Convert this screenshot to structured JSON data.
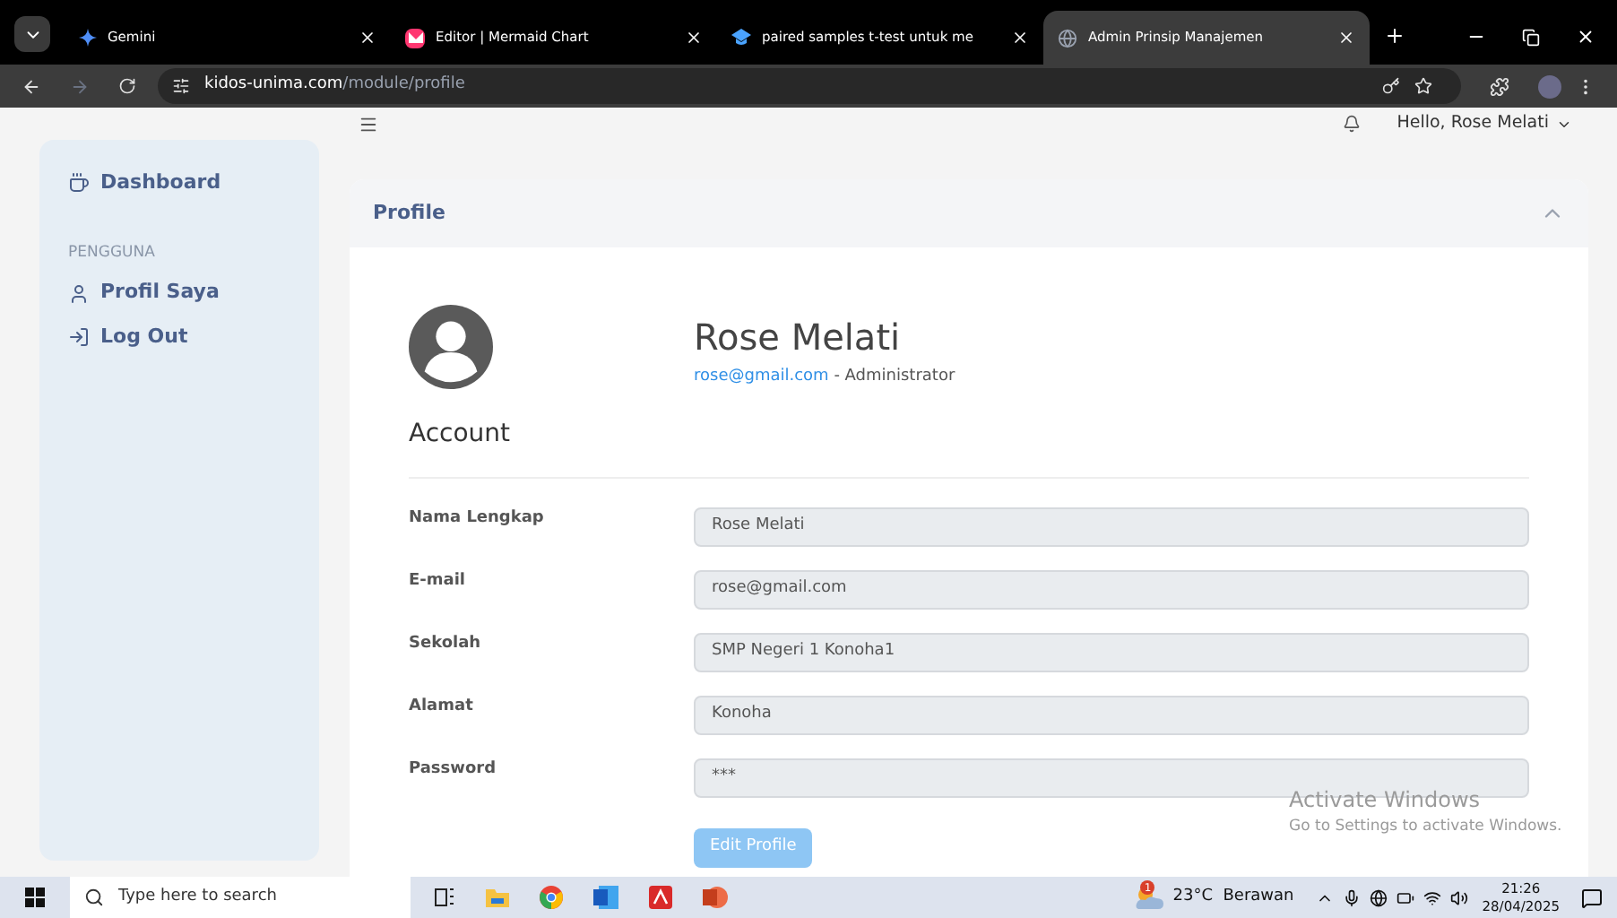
{
  "browser": {
    "tabs": [
      {
        "title": "Gemini",
        "kind": "gemini",
        "selected": false
      },
      {
        "title": "Editor | Mermaid Chart",
        "kind": "mermaid",
        "selected": false
      },
      {
        "title": "paired samples t-test untuk me",
        "kind": "edu",
        "selected": false
      },
      {
        "title": "Admin Prinsip Manajemen",
        "kind": "globe",
        "selected": true
      }
    ],
    "url_host": "kidos-unima.com",
    "url_path": "/module/profile"
  },
  "topbar": {
    "greeting": "Hello, Rose Melati"
  },
  "sidebar": {
    "items": [
      {
        "label": "Dashboard",
        "kind": "dashboard",
        "selected": false
      }
    ],
    "section": "PENGGUNA",
    "section_items": [
      {
        "label": "Profil Saya",
        "kind": "user",
        "selected": false
      },
      {
        "label": "Log Out",
        "kind": "logout",
        "selected": false
      }
    ]
  },
  "card": {
    "title": "Profile",
    "name": "Rose Melati",
    "email": "rose@gmail.com",
    "role": " - Administrator",
    "account_heading": "Account",
    "fields": [
      {
        "label": "Nama Lengkap",
        "value": "Rose Melati"
      },
      {
        "label": "E-mail",
        "value": "rose@gmail.com"
      },
      {
        "label": "Sekolah",
        "value": "SMP Negeri 1 Konoha1"
      },
      {
        "label": "Alamat",
        "value": "Konoha"
      },
      {
        "label": "Password",
        "value": "***"
      }
    ],
    "button": "Edit Profile"
  },
  "activation": {
    "title": "Activate Windows",
    "subtitle": "Go to Settings to activate Windows."
  },
  "taskbar": {
    "search_placeholder": "Type here to search",
    "weather": "23°C  Berawan",
    "weather_badge": "1",
    "time": "21:26",
    "date": "28/04/2025"
  }
}
